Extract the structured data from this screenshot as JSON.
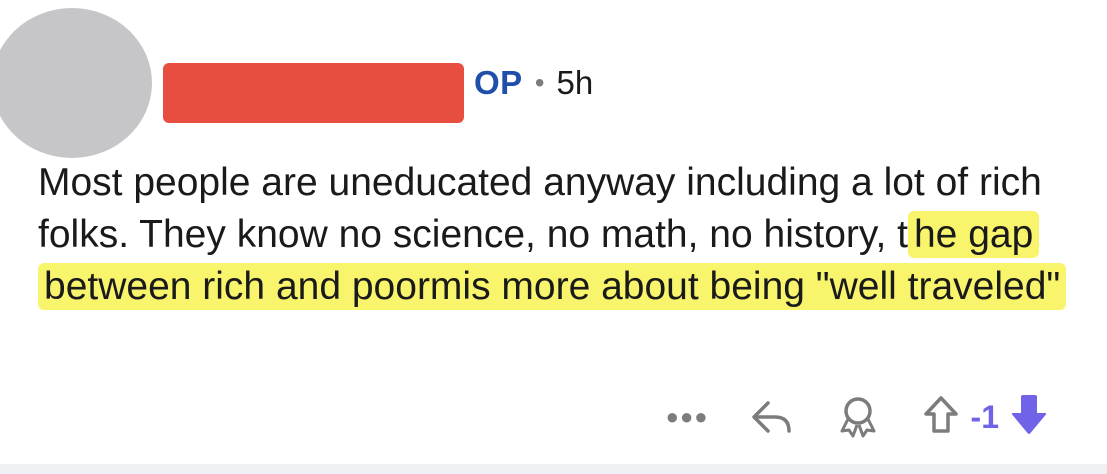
{
  "post": {
    "author_badge": "OP",
    "separator": "•",
    "time_ago": "5h",
    "text_plain": "Most people are uneducated anyway including a lot of rich folks. They know no science, no math, no history, t",
    "text_highlighted": "he gap between rich and poormis more about being \"well traveled\"",
    "highlight_color": "#f8f56c",
    "redaction_color": "#e84e40",
    "avatar_color": "#c6c6c8"
  },
  "actions": {
    "more_icon": "more-dots-icon",
    "reply_icon": "reply-icon",
    "award_icon": "award-icon",
    "upvote_icon": "upvote-icon",
    "downvote_icon": "downvote-icon",
    "score": "-1",
    "score_color": "#7163e8"
  }
}
